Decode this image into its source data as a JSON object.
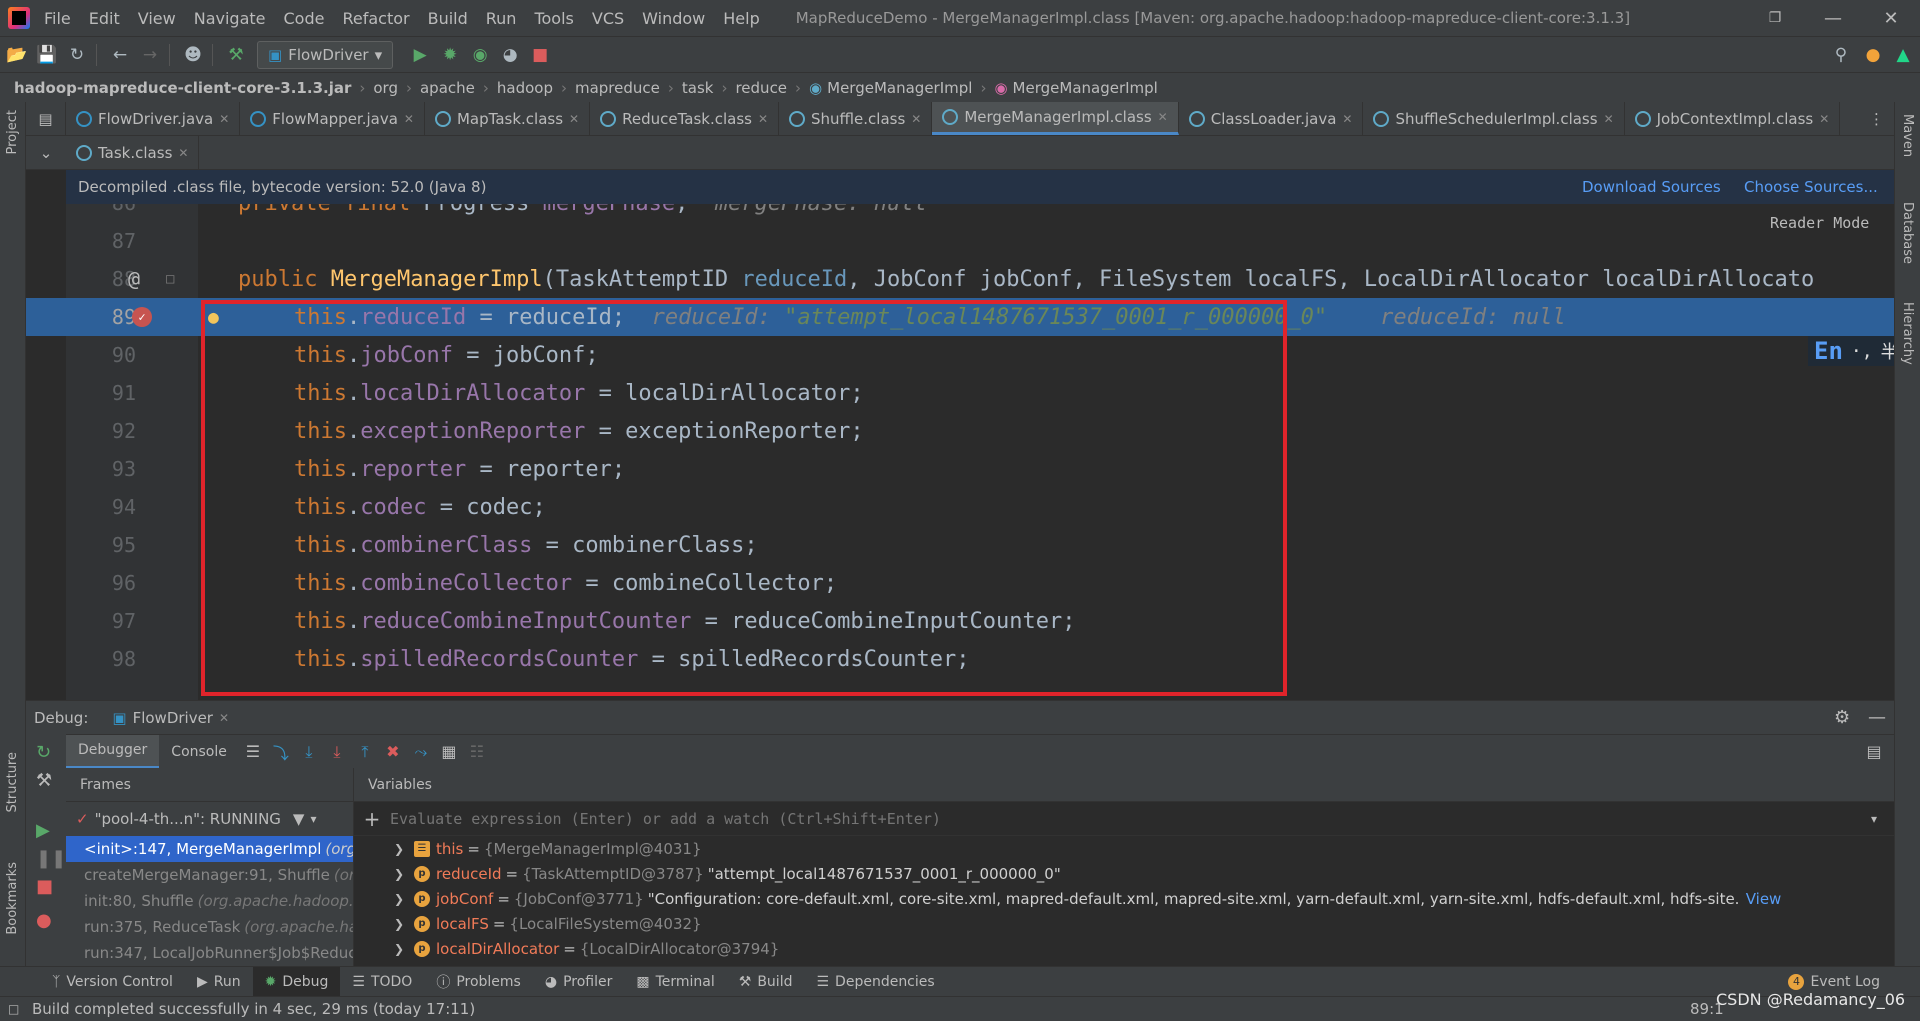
{
  "menubar": {
    "items": [
      "File",
      "Edit",
      "View",
      "Navigate",
      "Code",
      "Refactor",
      "Build",
      "Run",
      "Tools",
      "VCS",
      "Window",
      "Help"
    ],
    "window_title": "MapReduceDemo - MergeManagerImpl.class [Maven: org.apache.hadoop:hadoop-mapreduce-client-core:3.1.3]"
  },
  "toolbar": {
    "run_config": "FlowDriver"
  },
  "breadcrumb": [
    "hadoop-mapreduce-client-core-3.1.3.jar",
    "org",
    "apache",
    "hadoop",
    "mapreduce",
    "task",
    "reduce",
    "MergeManagerImpl",
    "MergeManagerImpl"
  ],
  "tabs_row1": [
    {
      "label": "FlowDriver.java"
    },
    {
      "label": "FlowMapper.java"
    },
    {
      "label": "MapTask.class"
    },
    {
      "label": "ReduceTask.class"
    },
    {
      "label": "Shuffle.class"
    },
    {
      "label": "MergeManagerImpl.class",
      "active": true
    },
    {
      "label": "ClassLoader.java"
    },
    {
      "label": "ShuffleSchedulerImpl.class"
    },
    {
      "label": "JobContextImpl.class"
    }
  ],
  "tabs_row2": [
    {
      "label": "Task.class"
    }
  ],
  "banner": {
    "text": "Decompiled .class file, bytecode version: 52.0 (Java 8)",
    "download": "Download Sources",
    "choose": "Choose Sources..."
  },
  "editor": {
    "reader_mode": "Reader Mode",
    "ime": {
      "lang": "En",
      "punct": "·,",
      "width": "半"
    },
    "lines": [
      {
        "num": "86",
        "pre": "    private final Progress ",
        "field": "mergePhase",
        "post": ";",
        "hint": "  mergePhase: null"
      },
      {
        "num": "87"
      },
      {
        "num": "88",
        "header": "public MergeManagerImpl(TaskAttemptID reduceId, JobConf jobConf, FileSystem localFS, LocalDirAllocator localDirAllocato"
      },
      {
        "num": "89",
        "field": "reduceId",
        "rhs": "reduceId",
        "hint_name": "reduceId: ",
        "hint_val": "\"attempt_local1487671537_0001_r_000000_0\"",
        "hint2": "reduceId: null"
      },
      {
        "num": "90",
        "field": "jobConf",
        "rhs": "jobConf"
      },
      {
        "num": "91",
        "field": "localDirAllocator",
        "rhs": "localDirAllocator"
      },
      {
        "num": "92",
        "field": "exceptionReporter",
        "rhs": "exceptionReporter"
      },
      {
        "num": "93",
        "field": "reporter",
        "rhs": "reporter"
      },
      {
        "num": "94",
        "field": "codec",
        "rhs": "codec"
      },
      {
        "num": "95",
        "field": "combinerClass",
        "rhs": "combinerClass"
      },
      {
        "num": "96",
        "field": "combineCollector",
        "rhs": "combineCollector"
      },
      {
        "num": "97",
        "field": "reduceCombineInputCounter",
        "rhs": "reduceCombineInputCounter"
      },
      {
        "num": "98",
        "field": "spilledRecordsCounter",
        "rhs": "spilledRecordsCounter"
      }
    ],
    "this_kw": "this",
    "header_parts": {
      "kw": "public ",
      "name": "MergeManagerImpl",
      "p1_type": "(TaskAttemptID ",
      "p1": "reduceId",
      "rest": ", JobConf jobConf, FileSystem localFS, LocalDirAllocator localDirAllocato"
    }
  },
  "debug": {
    "label": "Debug:",
    "config": "FlowDriver",
    "tabs": [
      "Debugger",
      "Console"
    ],
    "frames_title": "Frames",
    "thread": "\"pool-4-th...n\": RUNNING",
    "frames": [
      {
        "method": "<init>:147, MergeManagerImpl",
        "pkg": "(org.",
        "selected": true
      },
      {
        "method": "createMergeManager:91, Shuffle",
        "pkg": "(org.a"
      },
      {
        "method": "init:80, Shuffle",
        "pkg": "(org.apache.hadoop.m"
      },
      {
        "method": "run:375, ReduceTask",
        "pkg": "(org.apache.had"
      },
      {
        "method": "run:347, LocalJobRunner$Job$Reduc",
        "pkg": ""
      }
    ],
    "variables_title": "Variables",
    "eval_placeholder": "Evaluate expression (Enter) or add a watch (Ctrl+Shift+Enter)",
    "variables": [
      {
        "icon": "this",
        "name": "this",
        "type": "{MergeManagerImpl@4031}",
        "value": ""
      },
      {
        "icon": "p",
        "name": "reduceId",
        "type": "{TaskAttemptID@3787}",
        "value": "\"attempt_local1487671537_0001_r_000000_0\""
      },
      {
        "icon": "p",
        "name": "jobConf",
        "type": "{JobConf@3771}",
        "value": "\"Configuration: core-default.xml, core-site.xml, mapred-default.xml, mapred-site.xml, yarn-default.xml, yarn-site.xml, hdfs-default.xml, hdfs-site.xml, file:/tmp/hadoop",
        "link": "View"
      },
      {
        "icon": "p",
        "name": "localFS",
        "type": "{LocalFileSystem@4032}",
        "value": ""
      },
      {
        "icon": "p",
        "name": "localDirAllocator",
        "type": "{LocalDirAllocator@3794}",
        "value": ""
      }
    ]
  },
  "bottom_tabs": [
    "Version Control",
    "Run",
    "Debug",
    "TODO",
    "Problems",
    "Profiler",
    "Terminal",
    "Build",
    "Dependencies"
  ],
  "event_log": "Event Log",
  "status": {
    "text": "Build completed successfully in 4 sec, 29 ms (today 17:11)",
    "position": "89:1",
    "watermark": "CSDN @Redamancy_06"
  },
  "side": {
    "project": "Project",
    "structure": "Structure",
    "bookmarks": "Bookmarks",
    "maven": "Maven",
    "database": "Database",
    "hierarchy": "Hierarchy"
  }
}
